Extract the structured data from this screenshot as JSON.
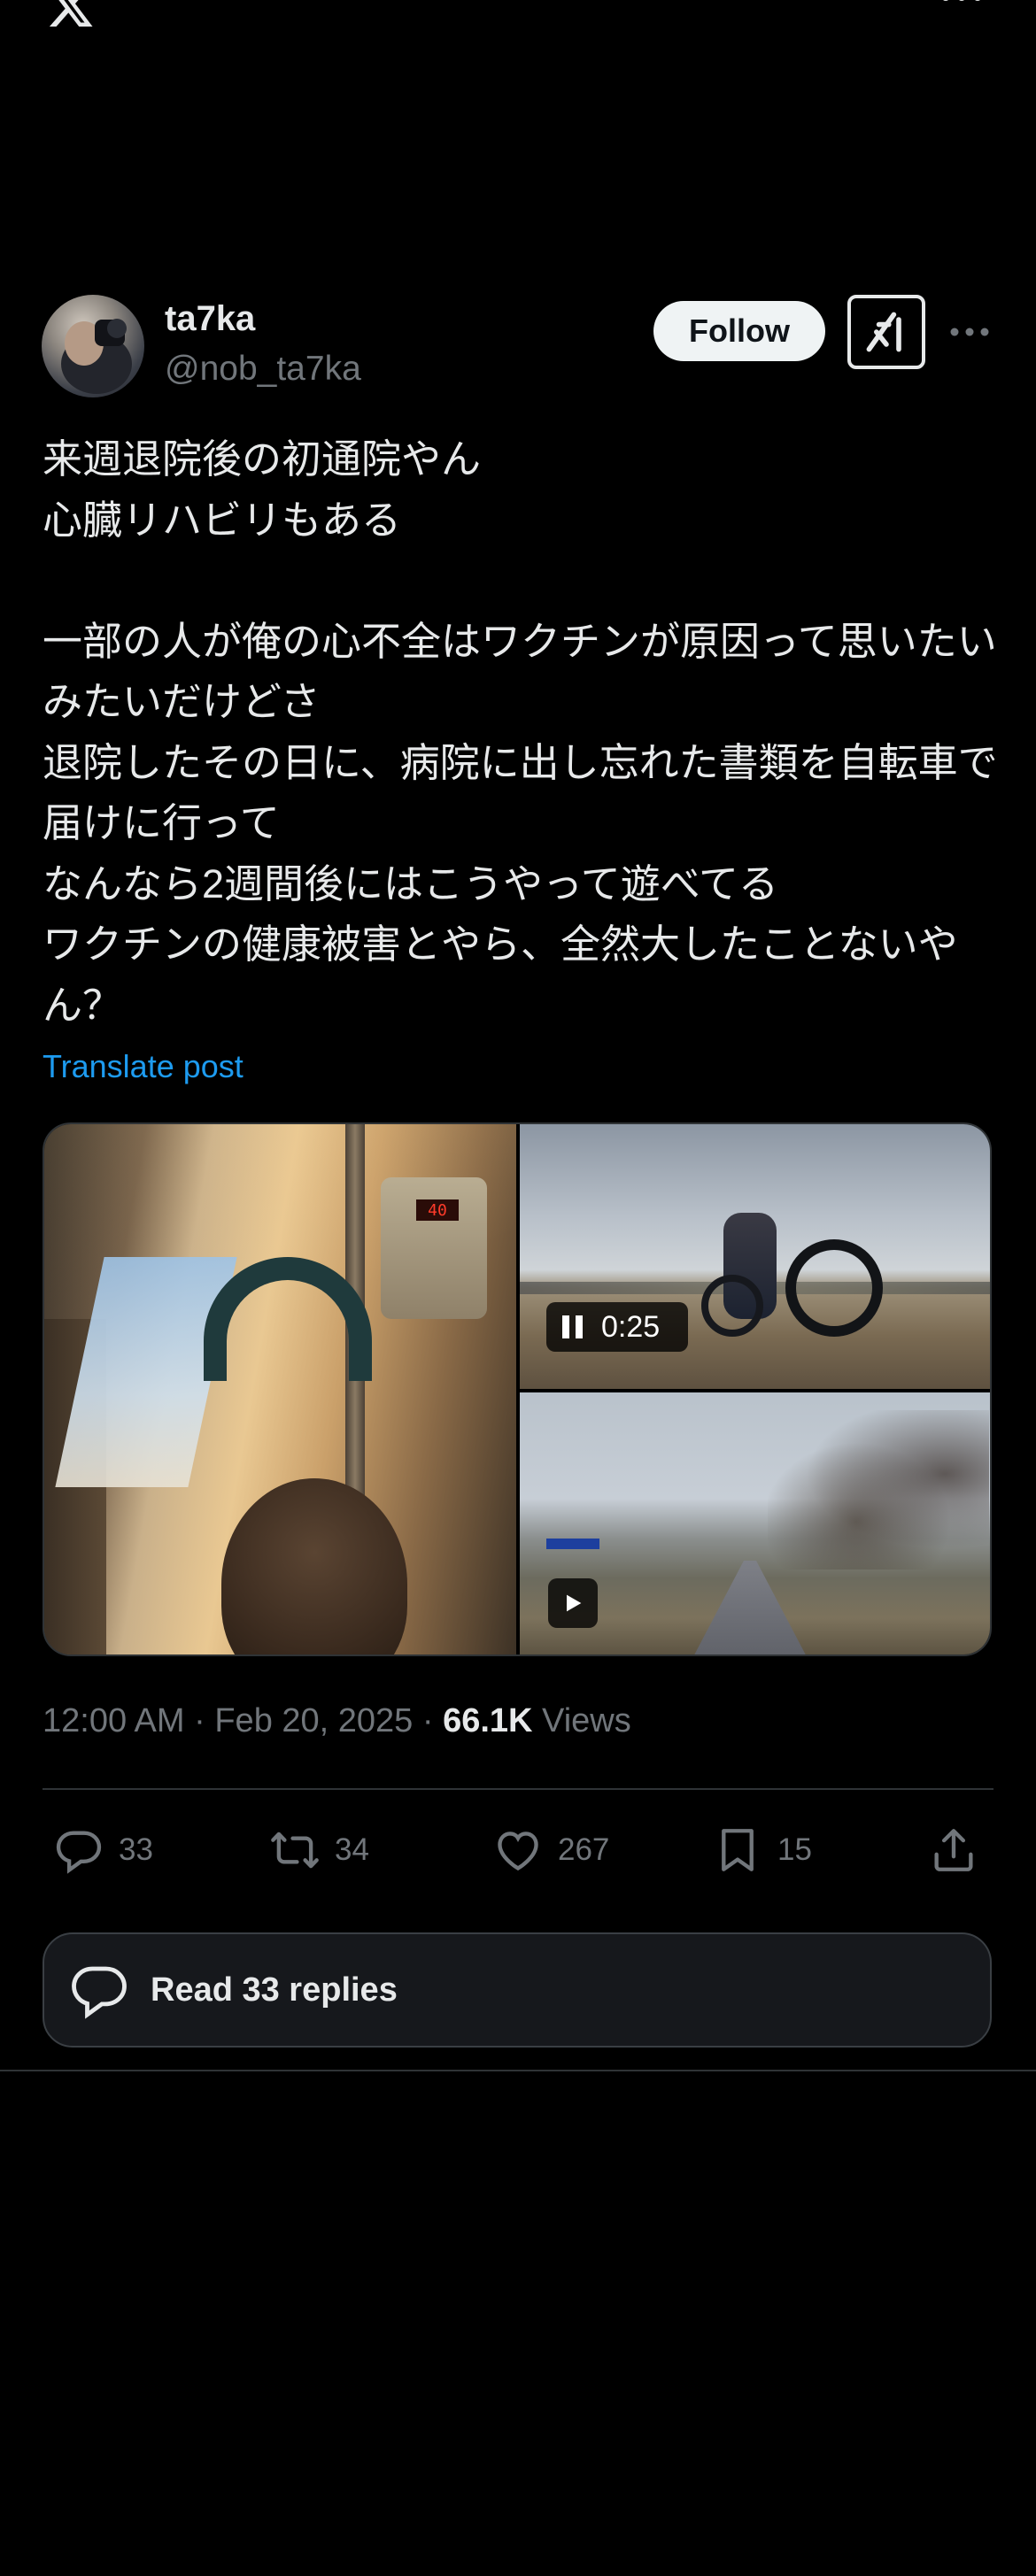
{
  "top_bar": {
    "logo_icon": "x-logo-icon",
    "more_icon": "more-horizontal-icon"
  },
  "author": {
    "display_name": "ta7ka",
    "handle": "@nob_ta7ka",
    "avatar": "avatar"
  },
  "header": {
    "follow_label": "Follow",
    "grok_icon": "grok-icon",
    "more_icon": "more-horizontal-icon"
  },
  "post": {
    "text": "来週退院後の初通院やん\n心臓リハビリもある\n\n一部の人が俺の心不全はワクチンが原因って思いたいみたいだけどさ\n退院したその日に、病院に出し忘れた書類を自転車で届けに行って\nなんなら2週間後にはこうやって遊べてる\nワクチンの健康被害とやら、全然大したことないやん？",
    "translate_label": "Translate post"
  },
  "media": {
    "video_duration": "0:25",
    "pump_display": "40",
    "video_state_icon": "pause-icon",
    "second_video_icon": "play-icon"
  },
  "meta": {
    "time": "12:00 AM",
    "sep1": " · ",
    "date": "Feb 20, 2025",
    "sep2": " · ",
    "views_count": "66.1K",
    "views_label": " Views"
  },
  "actions": {
    "replies": "33",
    "reposts": "34",
    "likes": "267",
    "bookmarks": "15"
  },
  "read_replies_label": "Read 33 replies",
  "colors": {
    "background": "#000000",
    "text_primary": "#e7e9ea",
    "text_secondary": "#71767b",
    "link": "#1d9bf0",
    "divider": "#2f3336"
  }
}
